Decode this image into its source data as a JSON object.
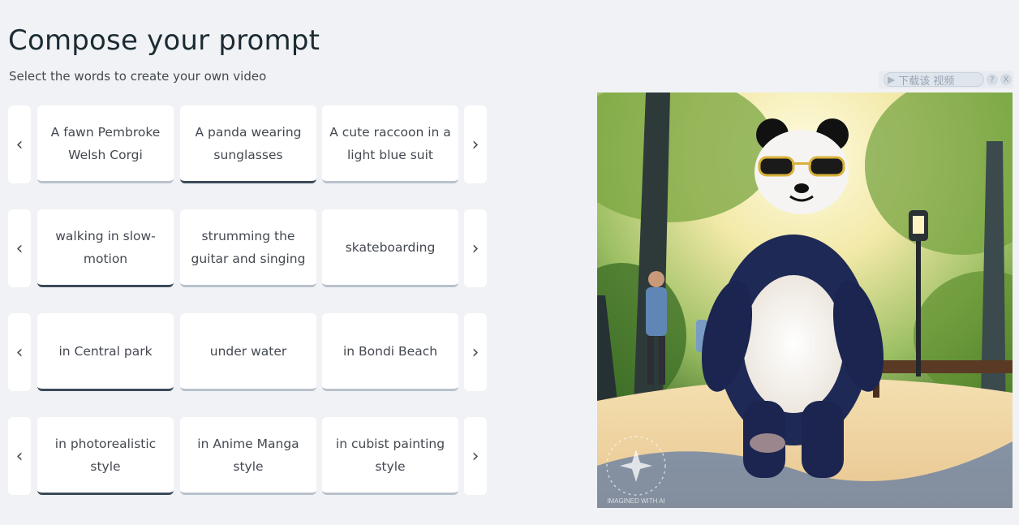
{
  "header": {
    "title": "Compose your prompt",
    "subtitle": "Select the words to create your own video"
  },
  "rows": [
    {
      "prev": "‹",
      "next": "›",
      "options": [
        "A fawn Pembroke Welsh Corgi",
        "A panda wearing sunglasses",
        "A cute raccoon in a light blue suit"
      ],
      "selected_index": 1
    },
    {
      "prev": "‹",
      "next": "›",
      "options": [
        "walking in slow-motion",
        "strumming the guitar and singing",
        "skateboarding"
      ],
      "selected_index": 0
    },
    {
      "prev": "‹",
      "next": "›",
      "options": [
        "in Central park",
        "under water",
        "in Bondi Beach"
      ],
      "selected_index": 0
    },
    {
      "prev": "‹",
      "next": "›",
      "options": [
        "in photorealistic style",
        "in Anime Manga style",
        "in cubist painting style"
      ],
      "selected_index": 0
    }
  ],
  "video_toolbar": {
    "download_label": "下载该 视频",
    "help_label": "?",
    "close_label": "X"
  },
  "video": {
    "watermark": "IMAGINED WITH AI"
  },
  "colors": {
    "background": "#f0f2f5",
    "card": "#ffffff",
    "selected_underline": "#3b4a59",
    "unselected_underline": "#b8c2cc"
  }
}
